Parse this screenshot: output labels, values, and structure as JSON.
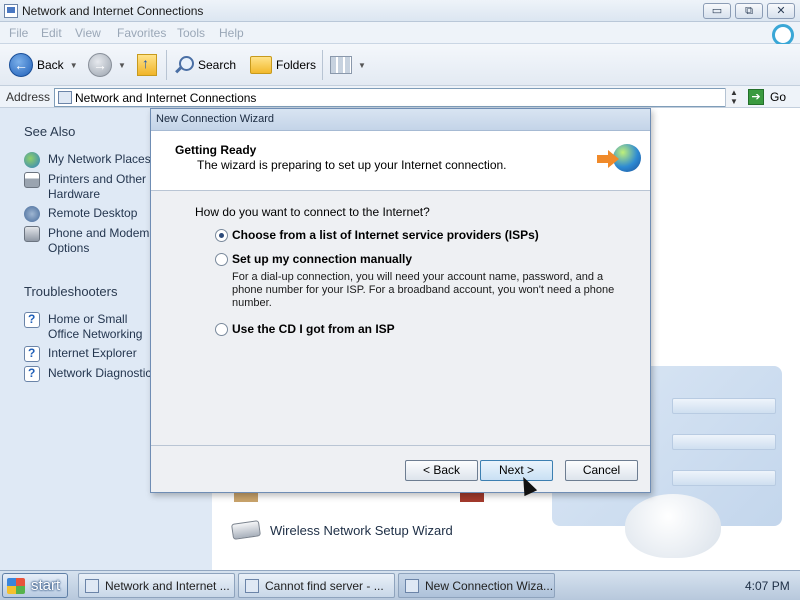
{
  "window": {
    "title": "Network and Internet Connections",
    "controls": {
      "minimize": "▭",
      "maximize": "⧉",
      "close": "✕"
    }
  },
  "menubar": {
    "items": [
      "File",
      "Edit",
      "View",
      "Favorites",
      "Tools",
      "Help"
    ]
  },
  "toolbar": {
    "back": "Back",
    "search": "Search",
    "folders": "Folders"
  },
  "address": {
    "label": "Address",
    "value": "Network and Internet Connections",
    "go": "Go"
  },
  "sidebar": {
    "see_also_title": "See Also",
    "see_also": [
      {
        "label": "My Network Places",
        "icon": "globe-icon"
      },
      {
        "label": "Printers and Other Hardware",
        "icon": "printer-icon"
      },
      {
        "label": "Remote Desktop",
        "icon": "remote-desktop-icon"
      },
      {
        "label": "Phone and Modem Options",
        "icon": "phone-icon"
      }
    ],
    "troubleshooters_title": "Troubleshooters",
    "troubleshooters": [
      {
        "label": "Home or Small Office Networking",
        "icon": "help-icon"
      },
      {
        "label": "Internet Explorer",
        "icon": "help-icon"
      },
      {
        "label": "Network Diagnostics",
        "icon": "help-icon"
      }
    ]
  },
  "main": {
    "wireless_link": "Wireless Network Setup Wizard"
  },
  "dialog": {
    "title": "New Connection Wizard",
    "header_title": "Getting Ready",
    "header_subtitle": "The wizard is preparing to set up your Internet connection.",
    "question": "How do you want to connect to the Internet?",
    "options": [
      {
        "label": "Choose from a list of Internet service providers (ISPs)",
        "checked": true
      },
      {
        "label": "Set up my connection manually",
        "checked": false
      },
      {
        "label": "Use the CD I got from an ISP",
        "checked": false
      }
    ],
    "manual_description": "For a dial-up connection, you will need your account name, password, and a phone number for your ISP. For a broadband account, you won't need a phone number.",
    "buttons": {
      "back": "< Back",
      "next": "Next >",
      "cancel": "Cancel"
    }
  },
  "taskbar": {
    "start": "start",
    "tasks": [
      {
        "label": "Network and Internet ...",
        "active": false
      },
      {
        "label": "Cannot find server - ...",
        "active": false
      },
      {
        "label": "New Connection Wiza...",
        "active": true
      }
    ],
    "clock": "4:07 PM"
  }
}
